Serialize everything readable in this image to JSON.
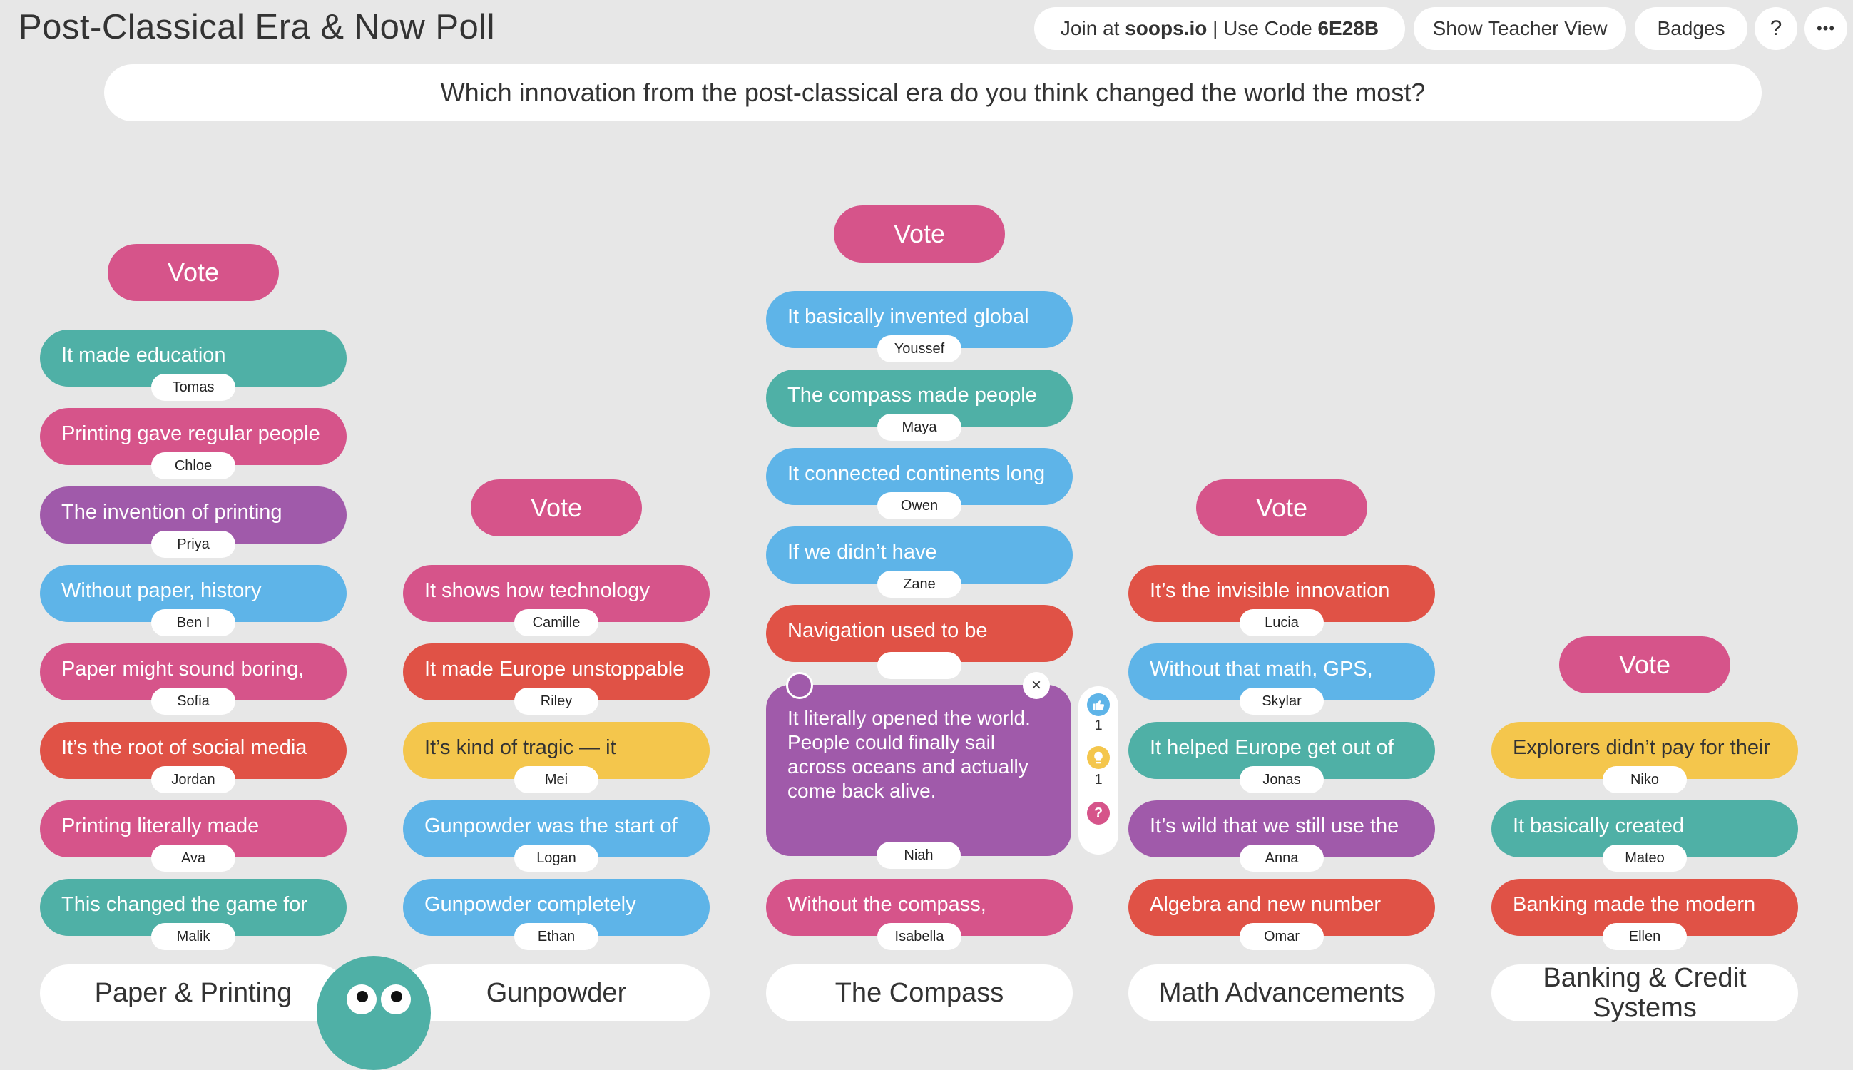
{
  "app": {
    "title": "Post-Classical Era & Now Poll"
  },
  "header": {
    "join_prefix": "Join at ",
    "join_site": "soops.io",
    "join_sep": " | Use Code ",
    "join_code": "6E28B",
    "teacher_view": "Show Teacher View",
    "badges": "Badges",
    "help": "?",
    "more": "•••"
  },
  "question": "Which innovation from the post-classical era do you think changed the world the most?",
  "vote_label": "Vote",
  "columns": [
    {
      "category": "Paper & Printing",
      "cards": [
        {
          "text": "It made education",
          "name": "Tomas",
          "color": "teal"
        },
        {
          "text": "Printing gave regular people",
          "name": "Chloe",
          "color": "pink"
        },
        {
          "text": "The invention of printing",
          "name": "Priya",
          "color": "purple"
        },
        {
          "text": "Without paper, history",
          "name": "Ben I",
          "color": "blue"
        },
        {
          "text": "Paper might sound boring,",
          "name": "Sofia",
          "color": "pink"
        },
        {
          "text": "It’s the root of social media",
          "name": "Jordan",
          "color": "red"
        },
        {
          "text": "Printing literally made",
          "name": "Ava",
          "color": "pink"
        },
        {
          "text": "This changed the game for",
          "name": "Malik",
          "color": "teal"
        }
      ]
    },
    {
      "category": "Gunpowder",
      "cards": [
        {
          "text": "It shows how technology",
          "name": "Camille",
          "color": "pink"
        },
        {
          "text": "It made Europe unstoppable",
          "name": "Riley",
          "color": "red"
        },
        {
          "text": "It’s kind of tragic — it",
          "name": "Mei",
          "color": "yellow"
        },
        {
          "text": "Gunpowder was the start of",
          "name": "Logan",
          "color": "blue"
        },
        {
          "text": "Gunpowder completely",
          "name": "Ethan",
          "color": "blue"
        }
      ]
    },
    {
      "category": "The Compass",
      "cards": [
        {
          "text": "It basically invented global",
          "name": "Youssef",
          "color": "blue"
        },
        {
          "text": "The compass made people",
          "name": "Maya",
          "color": "teal"
        },
        {
          "text": "It connected continents long",
          "name": "Owen",
          "color": "blue"
        },
        {
          "text": "If we didn’t have",
          "name": "Zane",
          "color": "blue"
        },
        {
          "text": "Navigation used to be",
          "name": "",
          "color": "red"
        },
        {
          "text": "Without the compass,",
          "name": "Isabella",
          "color": "pink"
        }
      ],
      "expanded": {
        "text": "It literally opened the world.\nPeople could finally sail\nacross oceans and actually\ncome back alive.",
        "name": "Niah",
        "close": "×",
        "likes": "1",
        "ideas": "1"
      }
    },
    {
      "category": "Math Advancements",
      "cards": [
        {
          "text": "It’s the invisible innovation",
          "name": "Lucia",
          "color": "red"
        },
        {
          "text": "Without that math, GPS,",
          "name": "Skylar",
          "color": "blue"
        },
        {
          "text": "It helped Europe get out of",
          "name": "Jonas",
          "color": "teal"
        },
        {
          "text": "It’s wild that we still use the",
          "name": "Anna",
          "color": "purple"
        },
        {
          "text": "Algebra and new number",
          "name": "Omar",
          "color": "red"
        }
      ]
    },
    {
      "category": "Banking & Credit Systems",
      "cards": [
        {
          "text": "Explorers didn’t pay for their",
          "name": "Niko",
          "color": "yellow"
        },
        {
          "text": "It basically created",
          "name": "Mateo",
          "color": "teal"
        },
        {
          "text": "Banking made the modern",
          "name": "Ellen",
          "color": "red"
        }
      ]
    }
  ],
  "colors": {
    "background": "#e7e7e7",
    "vote": "#d6548a",
    "teal": "#4fb0a6",
    "pink": "#d6548a",
    "purple": "#a05aaa",
    "blue": "#5eb4e8",
    "red": "#e05246",
    "yellow": "#f4c64c"
  },
  "icons": {
    "like": "thumbs-up-icon",
    "idea": "lightbulb-icon",
    "question": "question-icon",
    "close": "close-icon",
    "mascot": "mascot-icon"
  }
}
